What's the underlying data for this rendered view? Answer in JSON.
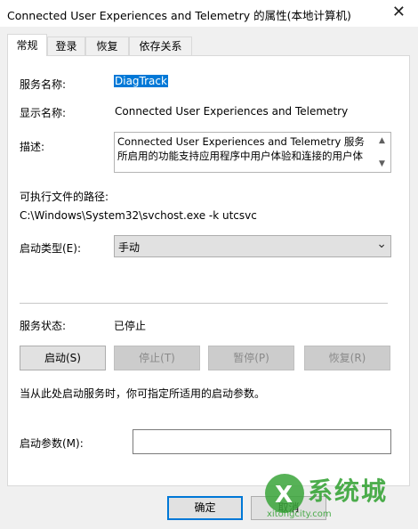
{
  "window": {
    "title": "Connected User Experiences and Telemetry 的属性(本地计算机)"
  },
  "tabs": [
    {
      "label": "常规",
      "active": true
    },
    {
      "label": "登录",
      "active": false
    },
    {
      "label": "恢复",
      "active": false
    },
    {
      "label": "依存关系",
      "active": false
    }
  ],
  "general": {
    "service_name_label": "服务名称:",
    "service_name_value": "DiagTrack",
    "display_name_label": "显示名称:",
    "display_name_value": "Connected User Experiences and Telemetry",
    "description_label": "描述:",
    "description_line1": "Connected User Experiences and Telemetry 服务",
    "description_line2": "所启用的功能支持应用程序中用户体验和连接的用户体",
    "exe_path_label": "可执行文件的路径:",
    "exe_path_value": "C:\\Windows\\System32\\svchost.exe -k utcsvc",
    "startup_type_label": "启动类型(E):",
    "startup_type_value": "手动",
    "status_label": "服务状态:",
    "status_value": "已停止",
    "start_button": "启动(S)",
    "stop_button": "停止(T)",
    "pause_button": "暂停(P)",
    "resume_button": "恢复(R)",
    "hint": "当从此处启动服务时，你可指定所适用的启动参数。",
    "params_label": "启动参数(M):",
    "params_value": ""
  },
  "footer": {
    "ok_button": "确定",
    "cancel_button": "取消"
  },
  "watermark": {
    "text1": "系统城",
    "text2": "xitongcity.com"
  },
  "colors": {
    "selection": "#0078d7",
    "accent_green": "#3aa53a"
  },
  "icons": {
    "close": "close-icon",
    "scroll_up": "scroll-up-icon",
    "scroll_down": "scroll-down-icon",
    "dropdown": "chevron-down-icon"
  }
}
